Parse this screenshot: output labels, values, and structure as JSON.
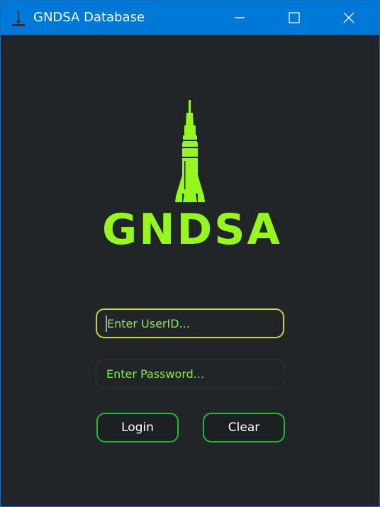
{
  "window": {
    "title": "GNDSA Database",
    "controls": {
      "minimize": "minimize-icon",
      "maximize": "maximize-icon",
      "close": "close-icon"
    }
  },
  "brand": {
    "name": "GNDSA",
    "logo_icon": "rocket-icon",
    "accent_color": "#95f81a"
  },
  "form": {
    "userid_placeholder": "Enter UserID...",
    "password_placeholder": "Enter Password...",
    "login_label": "Login",
    "clear_label": "Clear"
  },
  "colors": {
    "titlebar": "#0078d7",
    "background": "#212528",
    "button_border": "#21b93a",
    "focused_border": "#c8d334"
  }
}
